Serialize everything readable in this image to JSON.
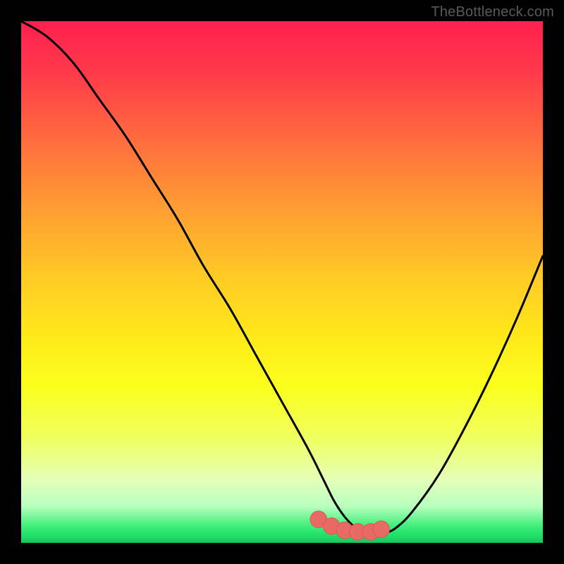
{
  "watermark": "TheBottleneck.com",
  "colors": {
    "frame": "#000000",
    "curve": "#000000",
    "marker_fill": "#e96a63",
    "marker_stroke": "#d85a54",
    "watermark_text": "#5a5a5a"
  },
  "gradient_stops": [
    {
      "offset": 0.0,
      "color": "#ff1f4f"
    },
    {
      "offset": 0.1,
      "color": "#ff3a4a"
    },
    {
      "offset": 0.22,
      "color": "#ff6a3f"
    },
    {
      "offset": 0.35,
      "color": "#ff9a34"
    },
    {
      "offset": 0.48,
      "color": "#ffc726"
    },
    {
      "offset": 0.6,
      "color": "#ffe81a"
    },
    {
      "offset": 0.7,
      "color": "#fbff1d"
    },
    {
      "offset": 0.8,
      "color": "#f0ff60"
    },
    {
      "offset": 0.88,
      "color": "#e3ffba"
    },
    {
      "offset": 0.93,
      "color": "#b7ffbe"
    },
    {
      "offset": 0.965,
      "color": "#48f07e"
    },
    {
      "offset": 0.985,
      "color": "#20e06a"
    },
    {
      "offset": 1.0,
      "color": "#1cc45a"
    }
  ],
  "chart_data": {
    "type": "line",
    "title": "",
    "xlabel": "",
    "ylabel": "",
    "xlim": [
      0,
      100
    ],
    "ylim": [
      0,
      100
    ],
    "series": [
      {
        "name": "bottleneck-curve",
        "x": [
          0,
          5,
          10,
          15,
          20,
          25,
          30,
          35,
          40,
          45,
          50,
          55,
          58,
          60,
          62,
          64,
          66,
          68,
          70,
          72,
          75,
          80,
          85,
          90,
          95,
          100
        ],
        "values": [
          100,
          97,
          92,
          85,
          78,
          70,
          62,
          53,
          45,
          36,
          27,
          18,
          12,
          8,
          5,
          3,
          2,
          2,
          2,
          3,
          6,
          13,
          22,
          32,
          43,
          55
        ]
      }
    ],
    "markers": {
      "name": "optimal-range",
      "x": [
        57,
        59.5,
        62,
        64.5,
        67,
        69
      ],
      "values": [
        4.5,
        3.2,
        2.4,
        2.1,
        2.1,
        2.6
      ],
      "radius_data_units": 1.6
    }
  }
}
